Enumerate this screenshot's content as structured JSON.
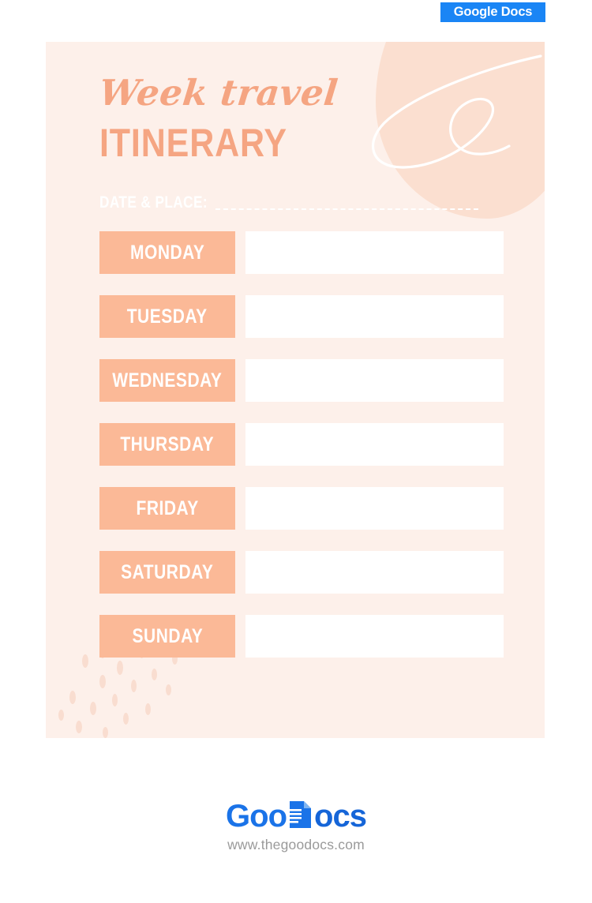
{
  "badge": {
    "label": "Google Docs",
    "color": "#1a85f5"
  },
  "card": {
    "background": "#fdf0ea",
    "accent": "#fbb997",
    "title_color": "#f5a582"
  },
  "header": {
    "script_title": "Week travel",
    "main_title": "ITINERARY",
    "date_place_label": "DATE & PLACE:"
  },
  "days": [
    {
      "label": "MONDAY",
      "note": ""
    },
    {
      "label": "TUESDAY",
      "note": ""
    },
    {
      "label": "WEDNESDAY",
      "note": ""
    },
    {
      "label": "THURSDAY",
      "note": ""
    },
    {
      "label": "FRIDAY",
      "note": ""
    },
    {
      "label": "SATURDAY",
      "note": ""
    },
    {
      "label": "SUNDAY",
      "note": ""
    }
  ],
  "footer": {
    "logo_before": "Goo",
    "logo_after": "ocs",
    "url": "www.thegoodocs.com",
    "logo_color": "#1a73e8",
    "url_color": "#9a9a9a"
  }
}
